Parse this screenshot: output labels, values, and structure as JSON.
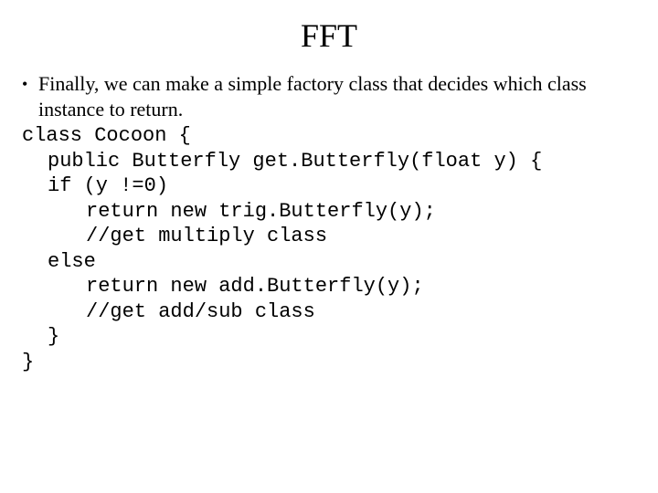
{
  "title": "FFT",
  "bullet_lead": "Finally, we can make a simple factory class that decides which class instance to return.",
  "code": {
    "l1": "class Cocoon {",
    "l2": "public Butterfly get.Butterfly(float y) {",
    "l3": "if (y !=0)",
    "l4": "return new trig.Butterfly(y);",
    "l5": "//get multiply class",
    "l6": "else",
    "l7": "return new add.Butterfly(y);",
    "l8": "//get add/sub class",
    "l9": "}",
    "l10": "}"
  }
}
